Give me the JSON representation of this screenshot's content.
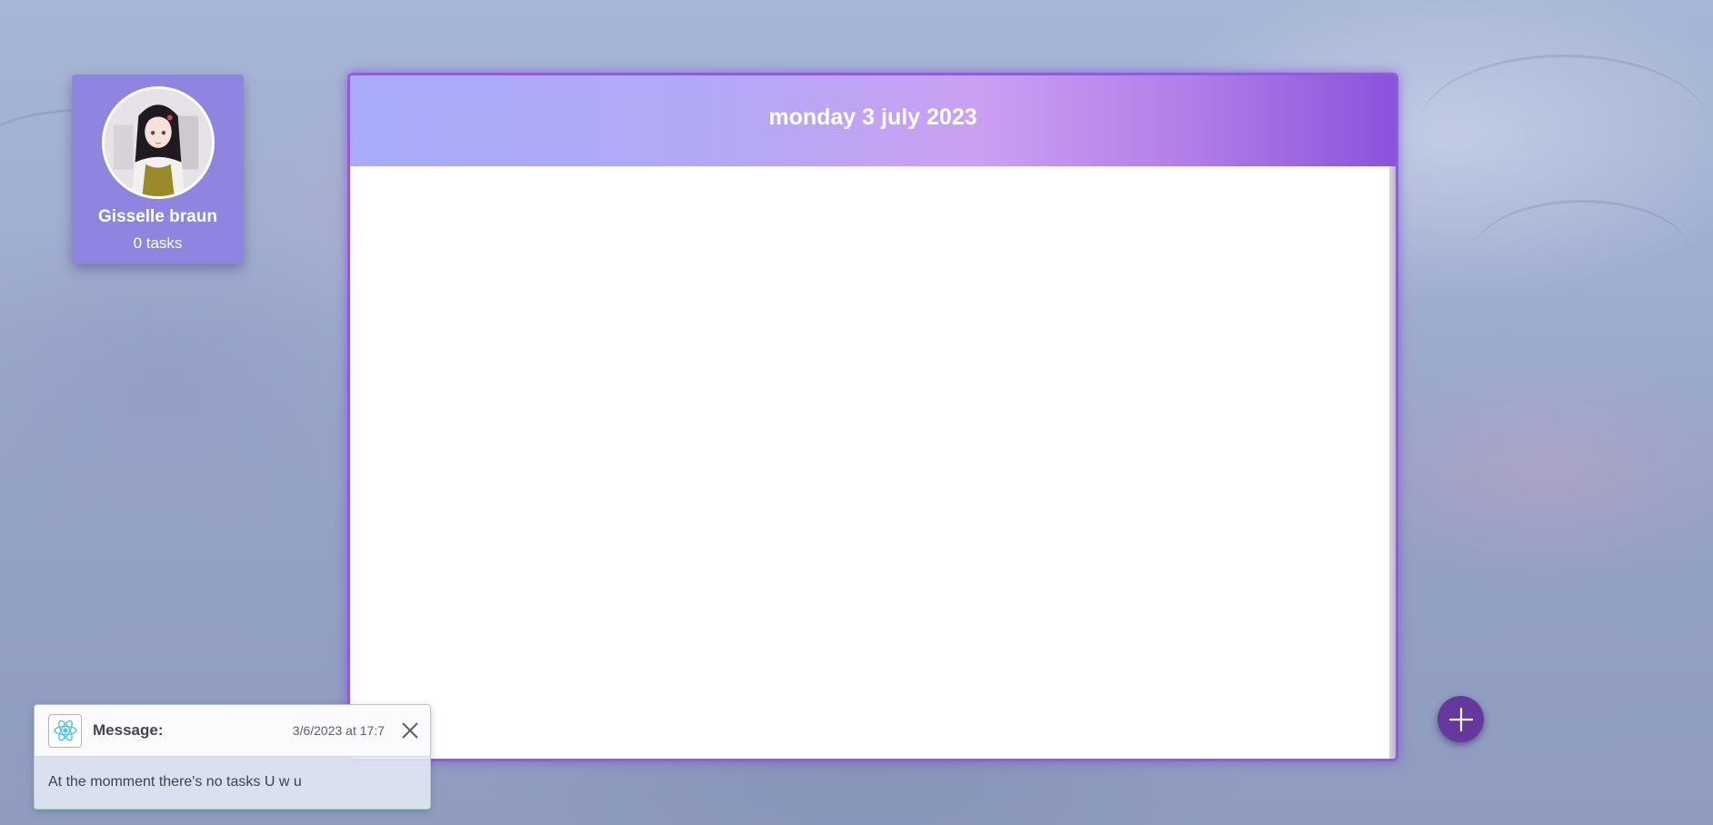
{
  "profile": {
    "name": "Gisselle braun",
    "tasks": "0 tasks"
  },
  "board": {
    "date_title": "monday 3 july 2023"
  },
  "add_button": {
    "icon": "plus-icon"
  },
  "toast": {
    "icon": "react-logo-icon",
    "title": "Message:",
    "timestamp": "3/6/2023 at 17:7",
    "message": "At the momment there's no tasks U w u",
    "close_icon": "close-icon"
  },
  "colors": {
    "card": "#8f84e0",
    "board_border": "#8f5ce0",
    "header_gradient_start": "#a8acfb",
    "header_gradient_end": "#8b52dc",
    "add_button": "#66389d"
  }
}
